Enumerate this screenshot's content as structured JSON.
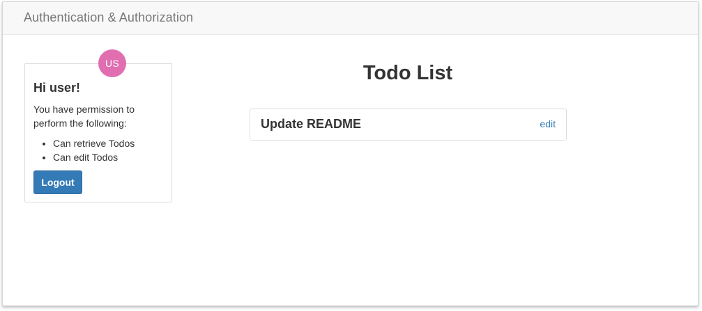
{
  "navbar": {
    "brand": "Authentication & Authorization"
  },
  "user_panel": {
    "avatar_initials": "US",
    "avatar_color": "#e06eb1",
    "greeting": "Hi user!",
    "permission_text": "You have permission to perform the following:",
    "permissions": [
      "Can retrieve Todos",
      "Can edit Todos"
    ],
    "logout_label": "Logout"
  },
  "todos": {
    "title": "Todo List",
    "items": [
      {
        "title": "Update README",
        "edit_label": "edit"
      }
    ]
  },
  "colors": {
    "primary": "#337ab7",
    "navbar_bg": "#f8f8f8"
  }
}
